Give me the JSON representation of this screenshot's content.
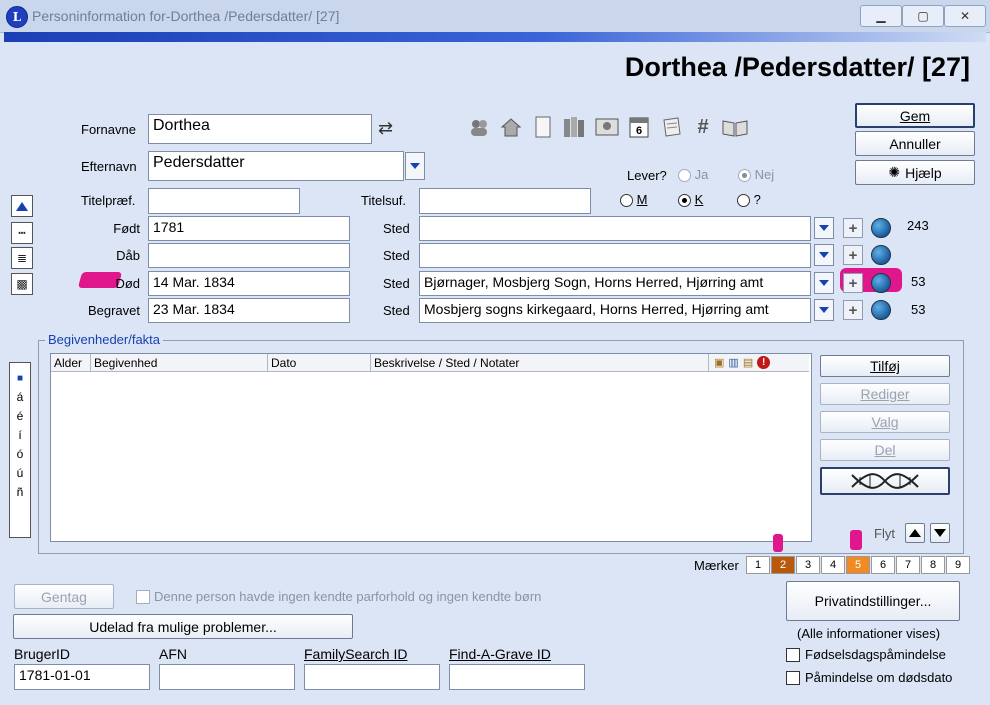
{
  "window": {
    "title": "Personinformation for-Dorthea /Pedersdatter/ [27]",
    "app_icon_letter": "L"
  },
  "header": {
    "name": "Dorthea /Pedersdatter/ [27]"
  },
  "form": {
    "fornavne_label": "Fornavne",
    "fornavne_value": "Dorthea",
    "efternavn_label": "Efternavn",
    "efternavn_value": "Pedersdatter",
    "titelpraef_label": "Titelpræf.",
    "titelpraef_value": "",
    "titelsuf_label": "Titelsuf.",
    "titelsuf_value": "",
    "swap_glyph": "⇄"
  },
  "lever": {
    "label": "Lever?",
    "ja": "Ja",
    "nej": "Nej",
    "selected": "Nej"
  },
  "gender": {
    "m": "M",
    "k": "K",
    "unknown": "?",
    "selected": "K"
  },
  "events": [
    {
      "label": "Født",
      "date": "1781",
      "sted_label": "Sted",
      "place": "",
      "count": "243"
    },
    {
      "label": "Dåb",
      "date": "",
      "sted_label": "Sted",
      "place": "",
      "count": ""
    },
    {
      "label": "Død",
      "date": "14 Mar. 1834",
      "sted_label": "Sted",
      "place": "Bjørnager, Mosbjerg Sogn, Horns Herred, Hjørring amt",
      "count": "53"
    },
    {
      "label": "Begravet",
      "date": "23 Mar. 1834",
      "sted_label": "Sted",
      "place": "Mosbjerg sogns kirkegaard, Horns Herred, Hjørring amt",
      "count": "53"
    }
  ],
  "buttons": {
    "gem": "Gem",
    "annuller": "Annuller",
    "hjaelp": "Hjælp",
    "tilfoj": "Tilføj",
    "rediger": "Rediger",
    "valg": "Valg",
    "del": "Del",
    "gentag": "Gentag",
    "udelad": "Udelad fra mulige problemer...",
    "privat": "Privatindstillinger..."
  },
  "facts": {
    "group_label": "Begivenheder/fakta",
    "columns": [
      "Alder",
      "Begivenhed",
      "Dato",
      "Beskrivelse / Sted / Notater"
    ],
    "rows": []
  },
  "flyt_label": "Flyt",
  "maerker": {
    "label": "Mærker",
    "items": [
      "1",
      "2",
      "3",
      "4",
      "5",
      "6",
      "7",
      "8",
      "9"
    ],
    "highlight": {
      "2": "#b85a0a",
      "5": "#f08a24"
    }
  },
  "side_chars": [
    "á",
    "é",
    "í",
    "ó",
    "ú",
    "ñ"
  ],
  "no_partners_text": "Denne person havde ingen kendte parforhold og ingen kendte børn",
  "all_info_text": "(Alle informationer vises)",
  "ids": {
    "bruger_label": "BrugerID",
    "bruger_value": "1781-01-01",
    "afn_label": "AFN",
    "afn_value": "",
    "fs_label": "FamilySearch ID",
    "fs_value": "",
    "fag_label": "Find-A-Grave ID",
    "fag_value": ""
  },
  "checks": {
    "birthday": "Fødselsdagspåmindelse",
    "death": "Påmindelse om dødsdato"
  },
  "toolbar_icons": [
    "people-icon",
    "house-icon",
    "document-icon",
    "books-icon",
    "photo-icon",
    "calendar-icon",
    "scroll-icon",
    "hash-icon",
    "open-book-icon"
  ],
  "calendar_day": "6",
  "hash_glyph": "#"
}
